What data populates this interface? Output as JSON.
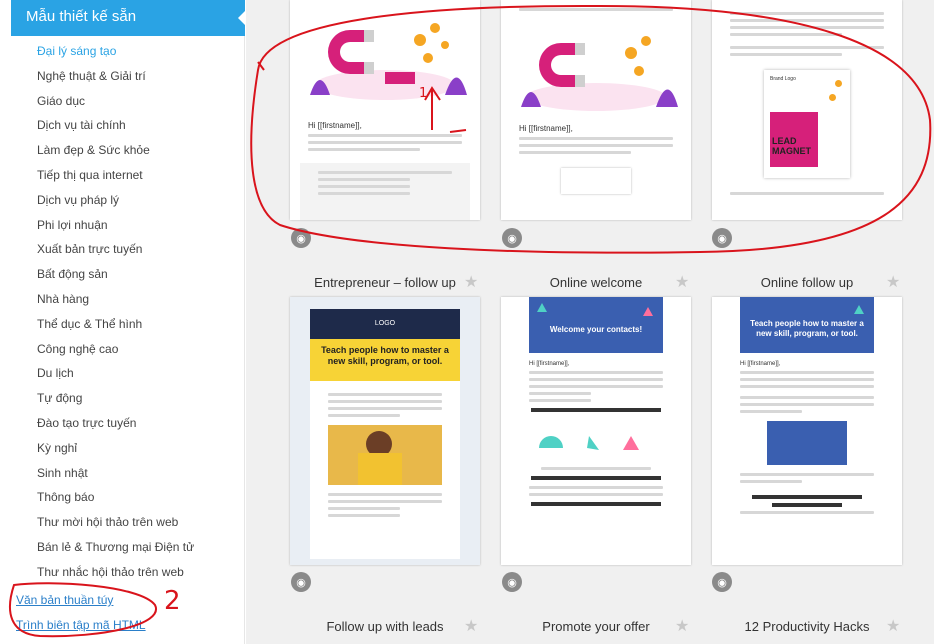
{
  "sidebar": {
    "header": "Mẫu thiết kế sẵn",
    "items": [
      {
        "label": "Đại lý sáng tạo",
        "active": true
      },
      {
        "label": "Nghệ thuật & Giải trí"
      },
      {
        "label": "Giáo dục"
      },
      {
        "label": "Dịch vụ tài chính"
      },
      {
        "label": "Làm đẹp & Sức khỏe"
      },
      {
        "label": "Tiếp thị qua internet"
      },
      {
        "label": "Dịch vụ pháp lý"
      },
      {
        "label": "Phi lợi nhuận"
      },
      {
        "label": "Xuất bản trực tuyến"
      },
      {
        "label": "Bất động sản"
      },
      {
        "label": "Nhà hàng"
      },
      {
        "label": "Thể dục & Thể hình"
      },
      {
        "label": "Công nghệ cao"
      },
      {
        "label": "Du lịch"
      },
      {
        "label": "Tự động"
      },
      {
        "label": "Đào tạo trực tuyến"
      },
      {
        "label": "Kỳ nghỉ"
      },
      {
        "label": "Sinh nhật"
      },
      {
        "label": "Thông báo"
      },
      {
        "label": "Thư mời hội thảo trên web"
      },
      {
        "label": "Bán lẻ & Thương mại Điện tử"
      },
      {
        "label": "Thư nhắc hội thảo trên web"
      }
    ],
    "links": {
      "plain_text": "Văn bản thuần túy",
      "html_editor": "Trình biên tập mã HTML"
    }
  },
  "annotations": [
    "1",
    "2"
  ],
  "templates": {
    "row1": [
      {
        "greeting": "Hi [[firstname]],"
      },
      {
        "greeting": "Hi [[firstname]],"
      },
      {
        "brand": "Brand Logo",
        "banner": "LEAD MAGNET"
      }
    ],
    "row2": [
      {
        "title": "Entrepreneur – follow up",
        "logo": "LOGO",
        "headline": "Teach people how to master a new skill, program, or tool."
      },
      {
        "title": "Online welcome",
        "headline": "Welcome your contacts!",
        "greeting": "Hi [[firstname]],"
      },
      {
        "title": "Online follow up",
        "headline": "Teach people how to master a new skill, program, or tool.",
        "greeting": "Hi [[firstname]],"
      }
    ],
    "row3": [
      {
        "title": "Follow up with leads"
      },
      {
        "title": "Promote your offer"
      },
      {
        "title": "12 Productivity Hacks"
      }
    ]
  },
  "colors": {
    "accent": "#2aa3e4",
    "annotation": "#d9141c",
    "email_yellow": "#f7d336",
    "email_navy": "#1e2a4a",
    "email_blue": "#3a5fb0"
  }
}
